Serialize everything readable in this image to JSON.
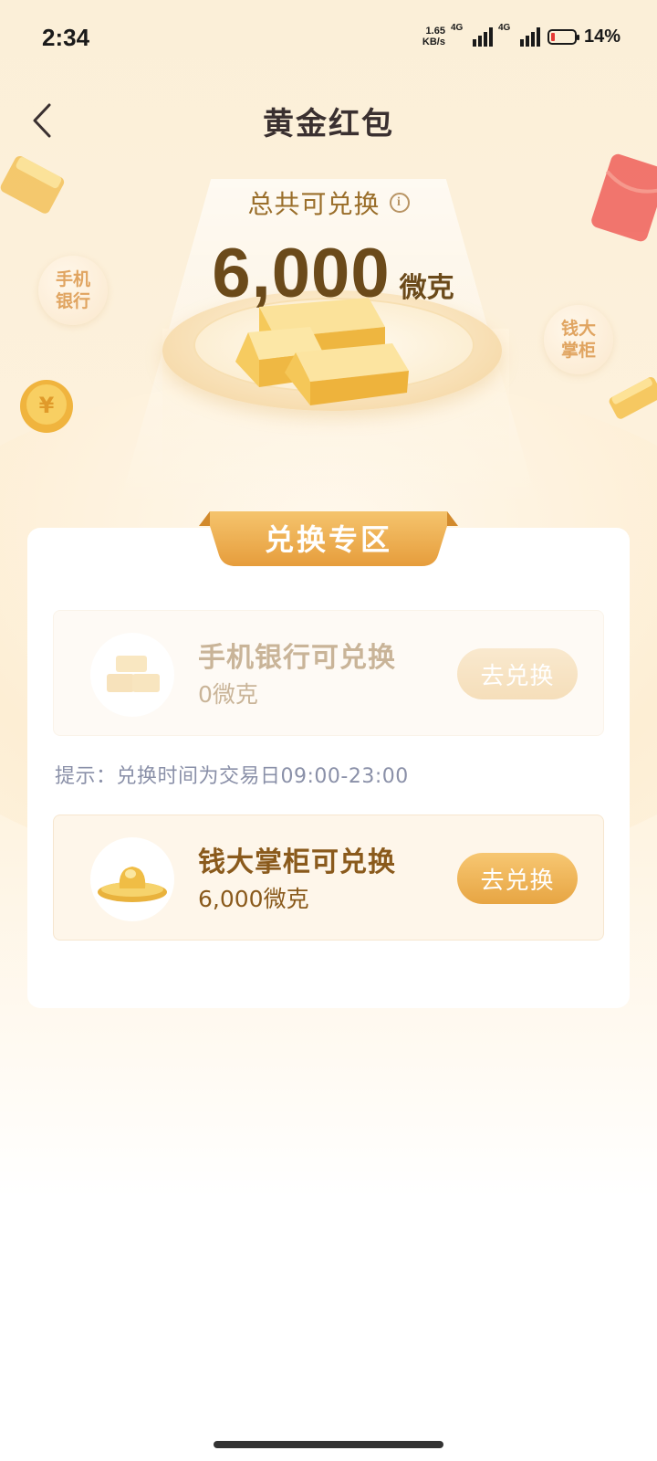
{
  "status_bar": {
    "time": "2:34",
    "net_speed_value": "1.65",
    "net_speed_unit": "KB/s",
    "signal_1_tag": "4G",
    "signal_2_tag": "4G",
    "battery_percent": "14%"
  },
  "nav": {
    "title": "黄金红包"
  },
  "hero": {
    "total_label": "总共可兑换",
    "total_amount": "6,000",
    "total_unit": "微克",
    "left_bubble": "手机\n银行",
    "right_bubble": "钱大\n掌柜"
  },
  "exchange": {
    "section_title": "兑换专区",
    "tip": "提示：兑换时间为交易日09:00-23:00",
    "items": [
      {
        "title": "手机银行可兑换",
        "amount": "0微克",
        "button": "去兑换",
        "enabled": false
      },
      {
        "title": "钱大掌柜可兑换",
        "amount": "6,000微克",
        "button": "去兑换",
        "enabled": true
      }
    ]
  },
  "colors": {
    "accent_gold": "#e7a543",
    "text_brown": "#6b4a1a",
    "title_dark": "#3a3030",
    "tip_gray": "#8a90a8"
  }
}
